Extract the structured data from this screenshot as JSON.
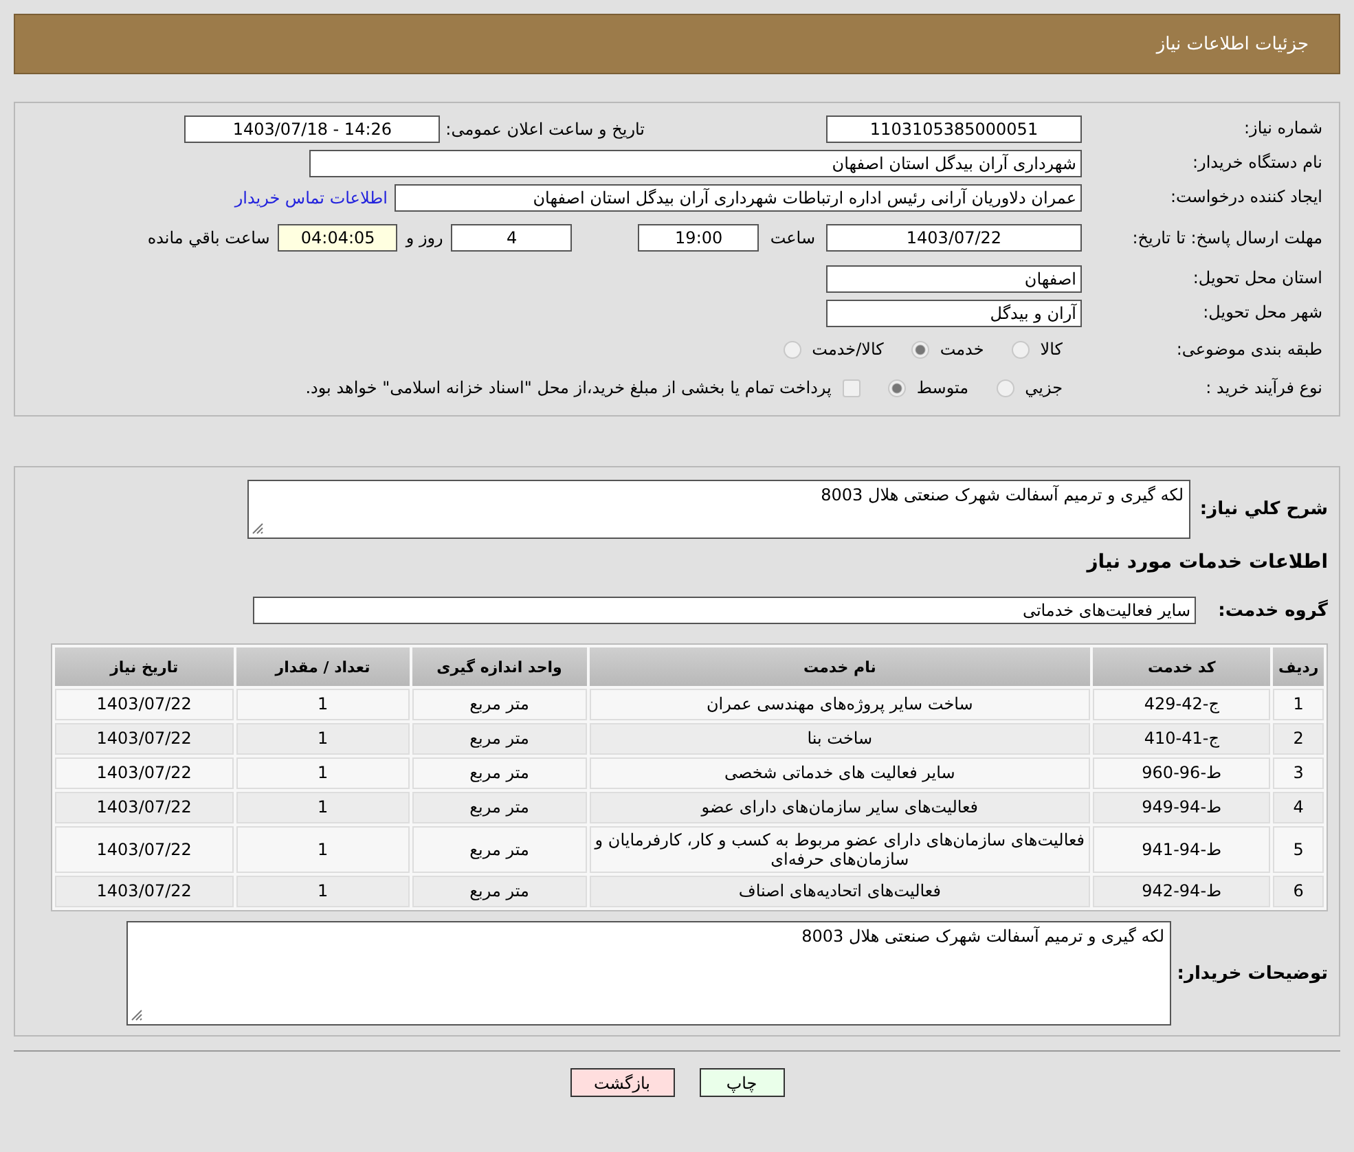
{
  "header": {
    "title": "جزئیات اطلاعات نیاز"
  },
  "details": {
    "need_number": {
      "label": "شماره نیاز:",
      "value": "1103105385000051"
    },
    "announce": {
      "label": "تاریخ و ساعت اعلان عمومی:",
      "value": "1403/07/18 - 14:26"
    },
    "buyer": {
      "label": "نام دستگاه خریدار:",
      "value": "شهرداری آران بیدگل استان اصفهان"
    },
    "creator": {
      "label": "ایجاد کننده درخواست:",
      "value": "عمران دلاوریان آرانی رئیس اداره ارتباطات شهرداری آران بیدگل استان اصفهان",
      "link": "اطلاعات تماس خریدار"
    },
    "deadline": {
      "label": "مهلت ارسال پاسخ: تا تاریخ:",
      "date": "1403/07/22",
      "time_label": "ساعت",
      "time": "19:00",
      "days": "4",
      "days_label": "روز و",
      "remaining": "04:04:05",
      "remaining_label": "ساعت باقي مانده"
    },
    "province": {
      "label": "استان محل تحویل:",
      "value": "اصفهان"
    },
    "city": {
      "label": "شهر محل تحویل:",
      "value": "آران و بیدگل"
    },
    "category": {
      "label": "طبقه بندی موضوعی:",
      "options": [
        {
          "label": "کالا",
          "selected": false
        },
        {
          "label": "خدمت",
          "selected": true
        },
        {
          "label": "کالا/خدمت",
          "selected": false
        }
      ]
    },
    "process": {
      "label": "نوع فرآیند خرید :",
      "options": [
        {
          "label": "جزيي",
          "selected": false
        },
        {
          "label": "متوسط",
          "selected": true
        }
      ],
      "payment": {
        "label": "پرداخت تمام یا بخشی از مبلغ خرید،از محل \"اسناد خزانه اسلامی\" خواهد بود.",
        "checked": false
      }
    }
  },
  "summary": {
    "label": "شرح کلي نياز:",
    "value": "لکه گیری و ترمیم آسفالت شهرک صنعتی هلال 8003"
  },
  "services_heading": "اطلاعات خدمات مورد نياز",
  "service_group": {
    "label": "گروه خدمت:",
    "value": "سایر فعالیت‌های خدماتی"
  },
  "table": {
    "columns": [
      "ردیف",
      "کد خدمت",
      "نام خدمت",
      "واحد اندازه گیری",
      "تعداد / مقدار",
      "تاریخ نیاز"
    ],
    "rows": [
      [
        "1",
        "ج-42-429",
        "ساخت سایر پروژه‌های مهندسی عمران",
        "متر مربع",
        "1",
        "1403/07/22"
      ],
      [
        "2",
        "ج-41-410",
        "ساخت بنا",
        "متر مربع",
        "1",
        "1403/07/22"
      ],
      [
        "3",
        "ط-96-960",
        "سایر فعالیت های خدماتی شخصی",
        "متر مربع",
        "1",
        "1403/07/22"
      ],
      [
        "4",
        "ط-94-949",
        "فعالیت‌های سایر سازمان‌های دارای عضو",
        "متر مربع",
        "1",
        "1403/07/22"
      ],
      [
        "5",
        "ط-94-941",
        "فعالیت‌های سازمان‌های دارای عضو مربوط به کسب و کار، کارفرمایان و سازمان‌های حرفه‌ای",
        "متر مربع",
        "1",
        "1403/07/22"
      ],
      [
        "6",
        "ط-94-942",
        "فعالیت‌های اتحادیه‌های اصناف",
        "متر مربع",
        "1",
        "1403/07/22"
      ]
    ]
  },
  "buyer_notes": {
    "label": "توضیحات خریدار:",
    "value": "لکه گیری و ترمیم آسفالت شهرک صنعتی هلال 8003"
  },
  "buttons": [
    {
      "label": "چاپ",
      "kind": "print"
    },
    {
      "label": "بازگشت",
      "kind": "back"
    }
  ]
}
